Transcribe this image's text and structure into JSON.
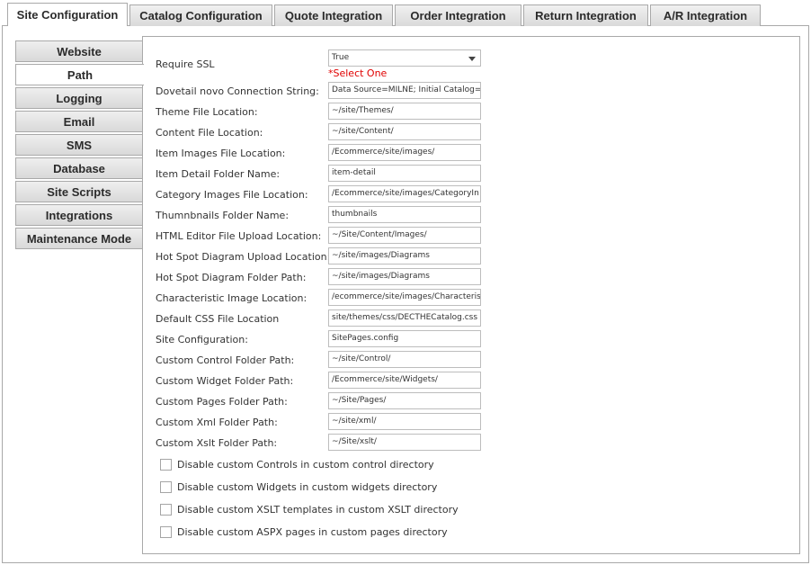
{
  "top_tabs": [
    {
      "label": "Site Configuration"
    },
    {
      "label": "Catalog Configuration"
    },
    {
      "label": "Quote Integration"
    },
    {
      "label": "Order Integration"
    },
    {
      "label": "Return Integration"
    },
    {
      "label": "A/R Integration"
    }
  ],
  "side_tabs": [
    {
      "label": "Website"
    },
    {
      "label": "Path"
    },
    {
      "label": "Logging"
    },
    {
      "label": "Email"
    },
    {
      "label": "SMS"
    },
    {
      "label": "Database"
    },
    {
      "label": "Site Scripts"
    },
    {
      "label": "Integrations"
    },
    {
      "label": "Maintenance Mode"
    }
  ],
  "require_ssl": {
    "label": "Require SSL",
    "value": "True",
    "validation": "*Select One"
  },
  "fields": [
    {
      "label": "Dovetail novo Connection String:",
      "value": "Data Source=MILNE; Initial Catalog="
    },
    {
      "label": "Theme File Location:",
      "value": "~/site/Themes/"
    },
    {
      "label": "Content File Location:",
      "value": "~/site/Content/"
    },
    {
      "label": "Item Images File Location:",
      "value": "/Ecommerce/site/images/"
    },
    {
      "label": "Item Detail Folder Name:",
      "value": "item-detail"
    },
    {
      "label": "Category Images File Location:",
      "value": "/Ecommerce/site/images/CategoryIn"
    },
    {
      "label": "Thumnbnails Folder Name:",
      "value": "thumbnails"
    },
    {
      "label": "HTML Editor File Upload Location:",
      "value": "~/Site/Content/Images/"
    },
    {
      "label": "Hot Spot Diagram Upload Location:",
      "value": "~/site/images/Diagrams"
    },
    {
      "label": "Hot Spot Diagram Folder Path:",
      "value": "~/site/images/Diagrams"
    },
    {
      "label": "Characteristic Image Location:",
      "value": "/ecommerce/site/images/Characteris"
    },
    {
      "label": "Default CSS File Location",
      "value": "site/themes/css/DECTHECatalog.css"
    },
    {
      "label": "Site Configuration:",
      "value": "SitePages.config"
    },
    {
      "label": "Custom Control Folder Path:",
      "value": "~/site/Control/"
    },
    {
      "label": "Custom Widget Folder Path:",
      "value": "/Ecommerce/site/Widgets/"
    },
    {
      "label": "Custom Pages Folder Path:",
      "value": "~/Site/Pages/"
    },
    {
      "label": "Custom Xml Folder Path:",
      "value": "~/site/xml/"
    },
    {
      "label": "Custom Xslt Folder Path:",
      "value": "~/Site/xslt/"
    }
  ],
  "checkboxes": [
    {
      "label": "Disable custom Controls in custom control directory"
    },
    {
      "label": "Disable custom Widgets in custom widgets directory"
    },
    {
      "label": "Disable custom XSLT templates in custom XSLT directory"
    },
    {
      "label": "Disable custom ASPX pages in custom pages directory"
    }
  ]
}
